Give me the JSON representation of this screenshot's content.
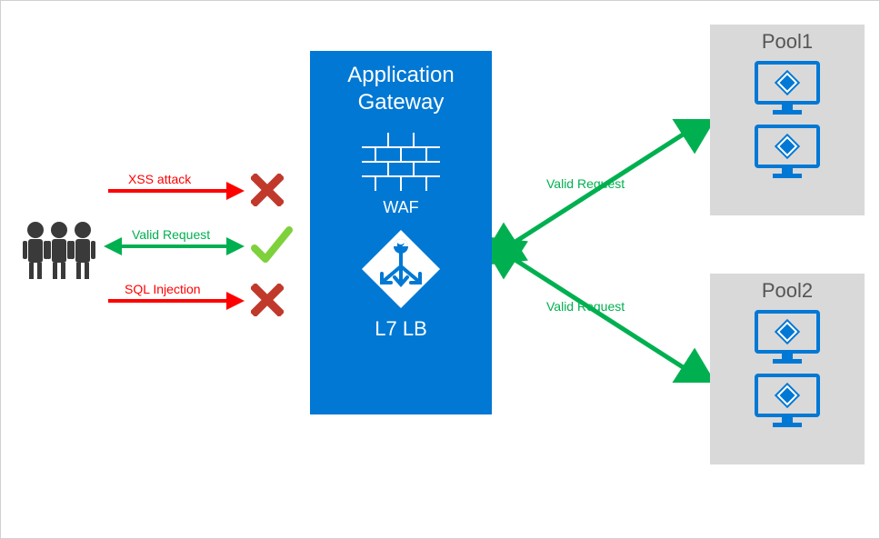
{
  "gateway": {
    "title_line1": "Application",
    "title_line2": "Gateway",
    "waf_label": "WAF",
    "lb_label": "L7 LB"
  },
  "requests": {
    "xss": "XSS attack",
    "valid": "Valid Request",
    "sqli": "SQL Injection"
  },
  "routes": {
    "to_pool1": "Valid Request",
    "to_pool2": "Valid Request"
  },
  "pools": {
    "pool1": "Pool1",
    "pool2": "Pool2"
  }
}
